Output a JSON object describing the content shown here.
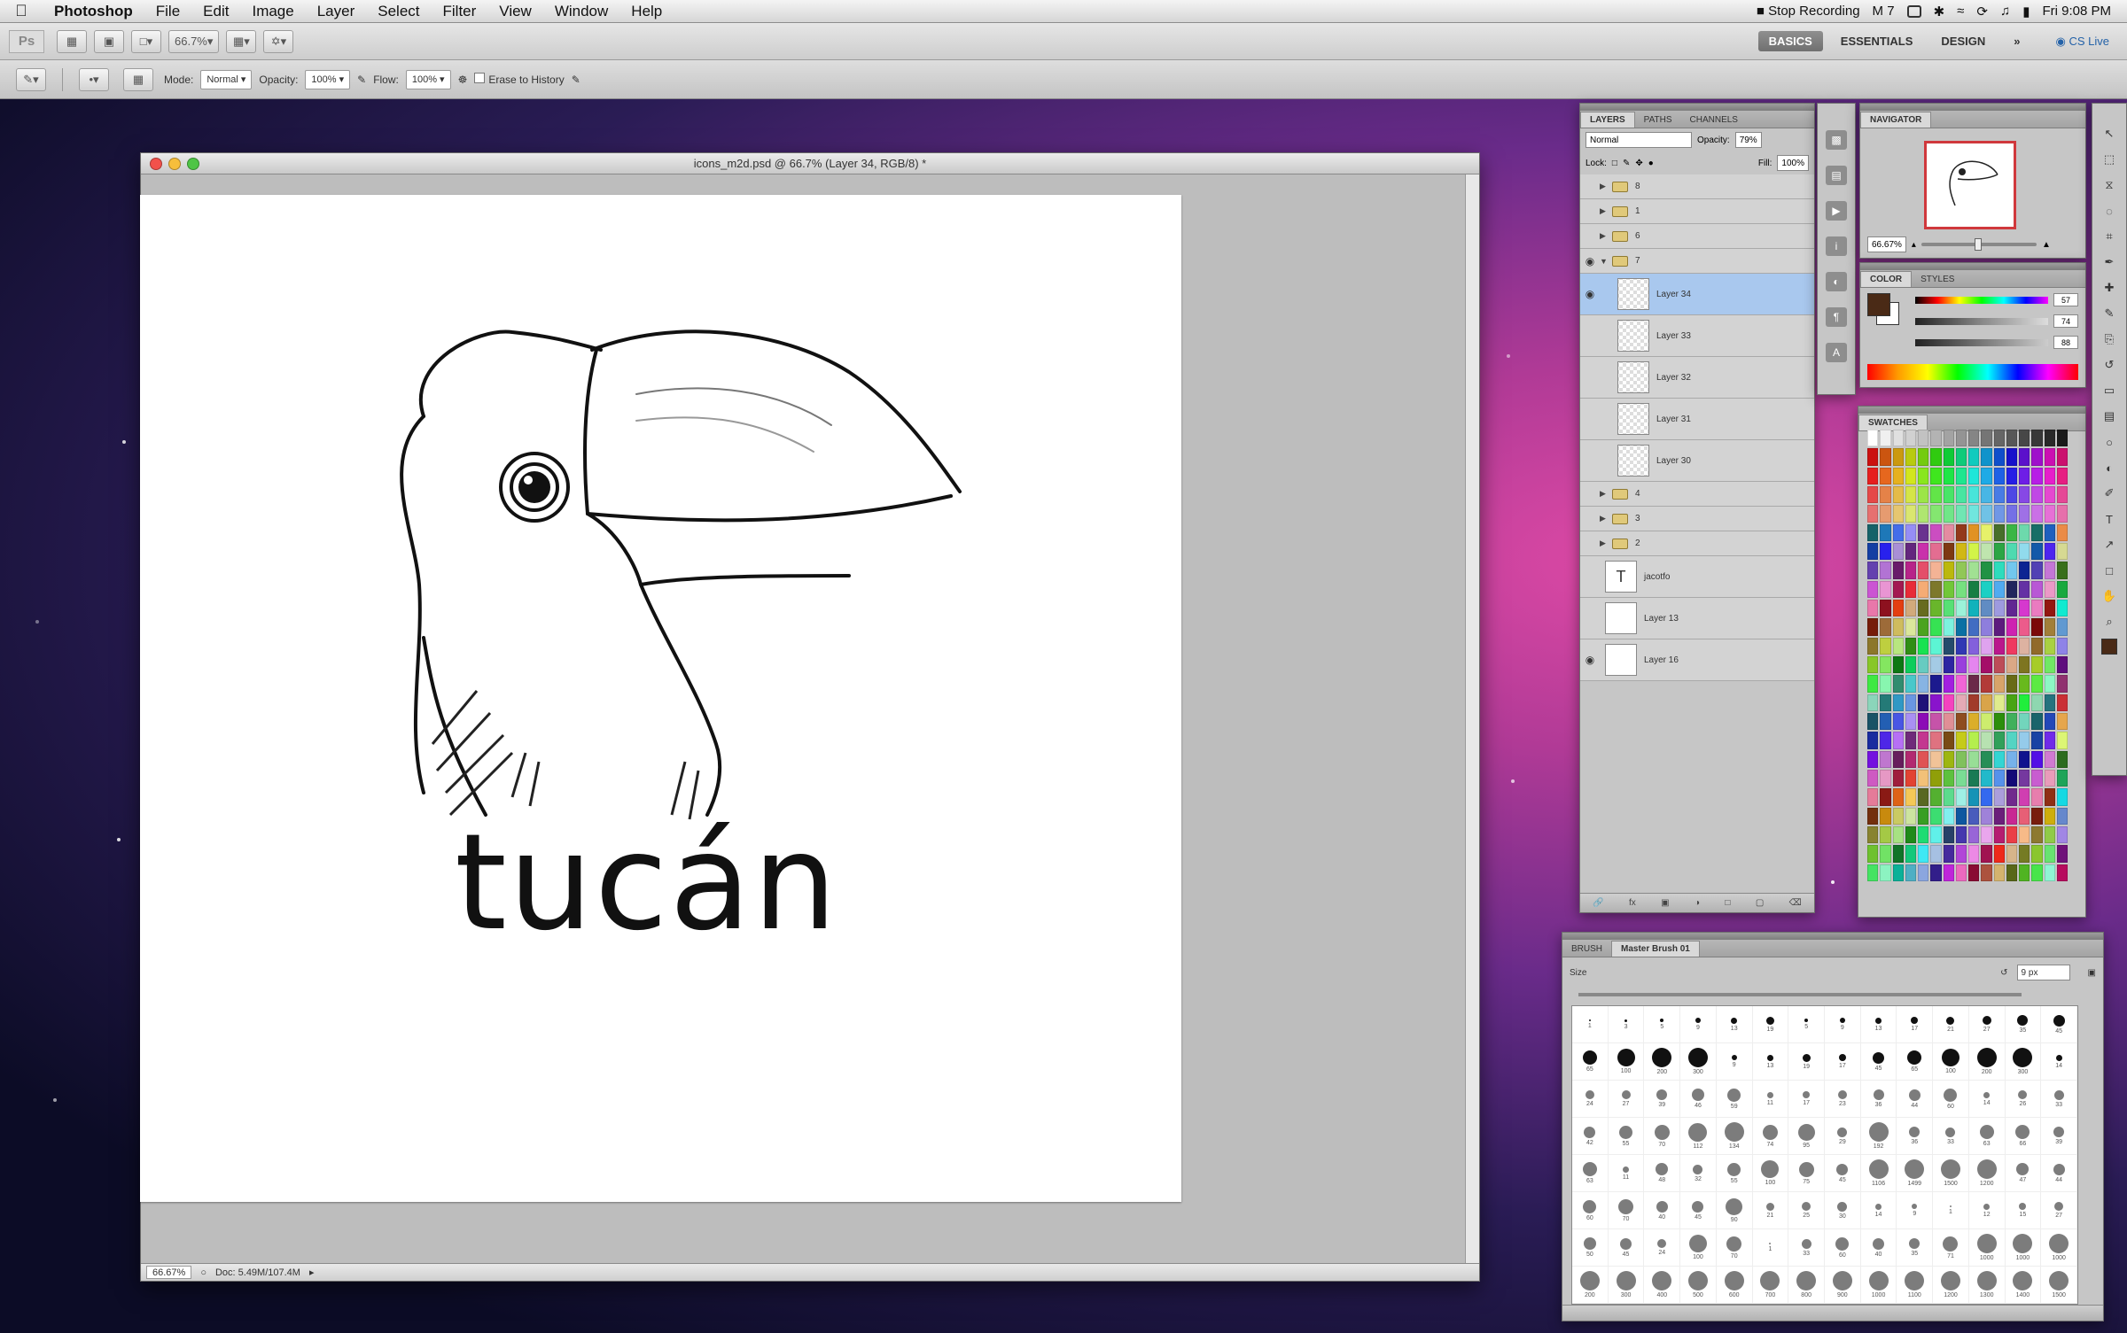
{
  "menubar": {
    "apple_icon": "apple-icon",
    "items": [
      "Photoshop",
      "File",
      "Edit",
      "Image",
      "Layer",
      "Select",
      "Filter",
      "View",
      "Window",
      "Help"
    ],
    "status": {
      "recording": "Stop Recording",
      "m_label": "M 7",
      "clock": "Fri 9:08 PM"
    }
  },
  "appbar": {
    "logo": "Ps",
    "zoom": "66.7%",
    "workspaces": [
      "BASICS",
      "ESSENTIALS",
      "DESIGN"
    ],
    "more": "»",
    "cs_live": "CS Live"
  },
  "options": {
    "mode_label": "Mode:",
    "mode_value": "Normal",
    "opacity_label": "Opacity:",
    "opacity_value": "100%",
    "flow_label": "Flow:",
    "flow_value": "100%",
    "erase_label": "Erase to History"
  },
  "document": {
    "title": "icons_m2d.psd @ 66.7% (Layer 34, RGB/8) *",
    "canvas_text": "tucán",
    "status_zoom": "66.67%",
    "status_doc": "Doc: 5.49M/107.4M"
  },
  "layers": {
    "tabs": [
      "LAYERS",
      "PATHS",
      "CHANNELS"
    ],
    "blend_mode": "Normal",
    "opacity_label": "Opacity:",
    "opacity_value": "79%",
    "lock_label": "Lock:",
    "fill_label": "Fill:",
    "fill_value": "100%",
    "rows": [
      {
        "name": "8",
        "type": "group",
        "eye": false
      },
      {
        "name": "1",
        "type": "group",
        "eye": false
      },
      {
        "name": "6",
        "type": "group",
        "eye": false
      },
      {
        "name": "7",
        "type": "group-open",
        "eye": true
      },
      {
        "name": "Layer 34",
        "type": "layer",
        "eye": true,
        "selected": true
      },
      {
        "name": "Layer 33",
        "type": "layer",
        "eye": false
      },
      {
        "name": "Layer 32",
        "type": "layer",
        "eye": false
      },
      {
        "name": "Layer 31",
        "type": "layer",
        "eye": false
      },
      {
        "name": "Layer 30",
        "type": "layer",
        "eye": false
      },
      {
        "name": "4",
        "type": "group",
        "eye": false
      },
      {
        "name": "3",
        "type": "group",
        "eye": false
      },
      {
        "name": "2",
        "type": "group",
        "eye": false
      },
      {
        "name": "jacotfo",
        "type": "text",
        "eye": false
      },
      {
        "name": "Layer 13",
        "type": "layer-white",
        "eye": false
      },
      {
        "name": "Layer 16",
        "type": "layer-white",
        "eye": true
      }
    ],
    "footer_icons": [
      "link-icon",
      "fx-icon",
      "mask-icon",
      "adjustment-icon",
      "folder-icon",
      "new-layer-icon",
      "trash-icon"
    ]
  },
  "navigator": {
    "tabs": [
      "NAVIGATOR"
    ],
    "zoom": "66.67%"
  },
  "color": {
    "tabs": [
      "COLOR",
      "STYLES"
    ],
    "values": [
      "57",
      "74",
      "88"
    ],
    "fg_color": "#4a2a16"
  },
  "swatches": {
    "tabs": [
      "SWATCHES"
    ]
  },
  "brushes": {
    "tabs": [
      "BRUSH",
      "Master Brush 01"
    ],
    "size_label": "Size",
    "size_value": "9 px",
    "rows": [
      [
        1,
        3,
        5,
        9,
        13,
        19,
        5,
        9,
        13,
        17,
        21,
        27,
        35,
        45
      ],
      [
        65,
        100,
        200,
        300,
        9,
        13,
        19,
        17,
        45,
        65,
        100,
        200,
        300,
        14
      ],
      [
        24,
        27,
        39,
        46,
        59,
        11,
        17,
        23,
        36,
        44,
        60,
        14,
        26,
        33
      ],
      [
        42,
        55,
        70,
        112,
        134,
        74,
        95,
        29,
        192,
        36,
        33,
        63,
        66,
        39
      ],
      [
        63,
        11,
        48,
        32,
        55,
        100,
        75,
        45,
        1106,
        1499,
        1500,
        1200,
        47,
        44
      ],
      [
        60,
        70,
        40,
        45,
        90,
        21,
        25,
        30,
        14,
        9,
        1,
        12,
        15,
        27
      ],
      [
        50,
        45,
        24,
        100,
        70,
        1,
        33,
        60,
        40,
        35,
        71,
        1000,
        1000,
        1000
      ],
      [
        200,
        300,
        400,
        500,
        600,
        700,
        800,
        900,
        1000,
        1100,
        1200,
        1300,
        1400,
        1500
      ]
    ]
  },
  "tools": [
    "move-tool-icon",
    "marquee-tool-icon",
    "lasso-tool-icon",
    "quick-select-tool-icon",
    "crop-tool-icon",
    "eyedropper-tool-icon",
    "healing-tool-icon",
    "brush-tool-icon",
    "clone-stamp-tool-icon",
    "history-brush-tool-icon",
    "eraser-tool-icon",
    "gradient-tool-icon",
    "blur-tool-icon",
    "dodge-tool-icon",
    "pen-tool-icon",
    "type-tool-icon",
    "path-select-tool-icon",
    "shape-tool-icon",
    "hand-tool-icon",
    "zoom-tool-icon"
  ]
}
